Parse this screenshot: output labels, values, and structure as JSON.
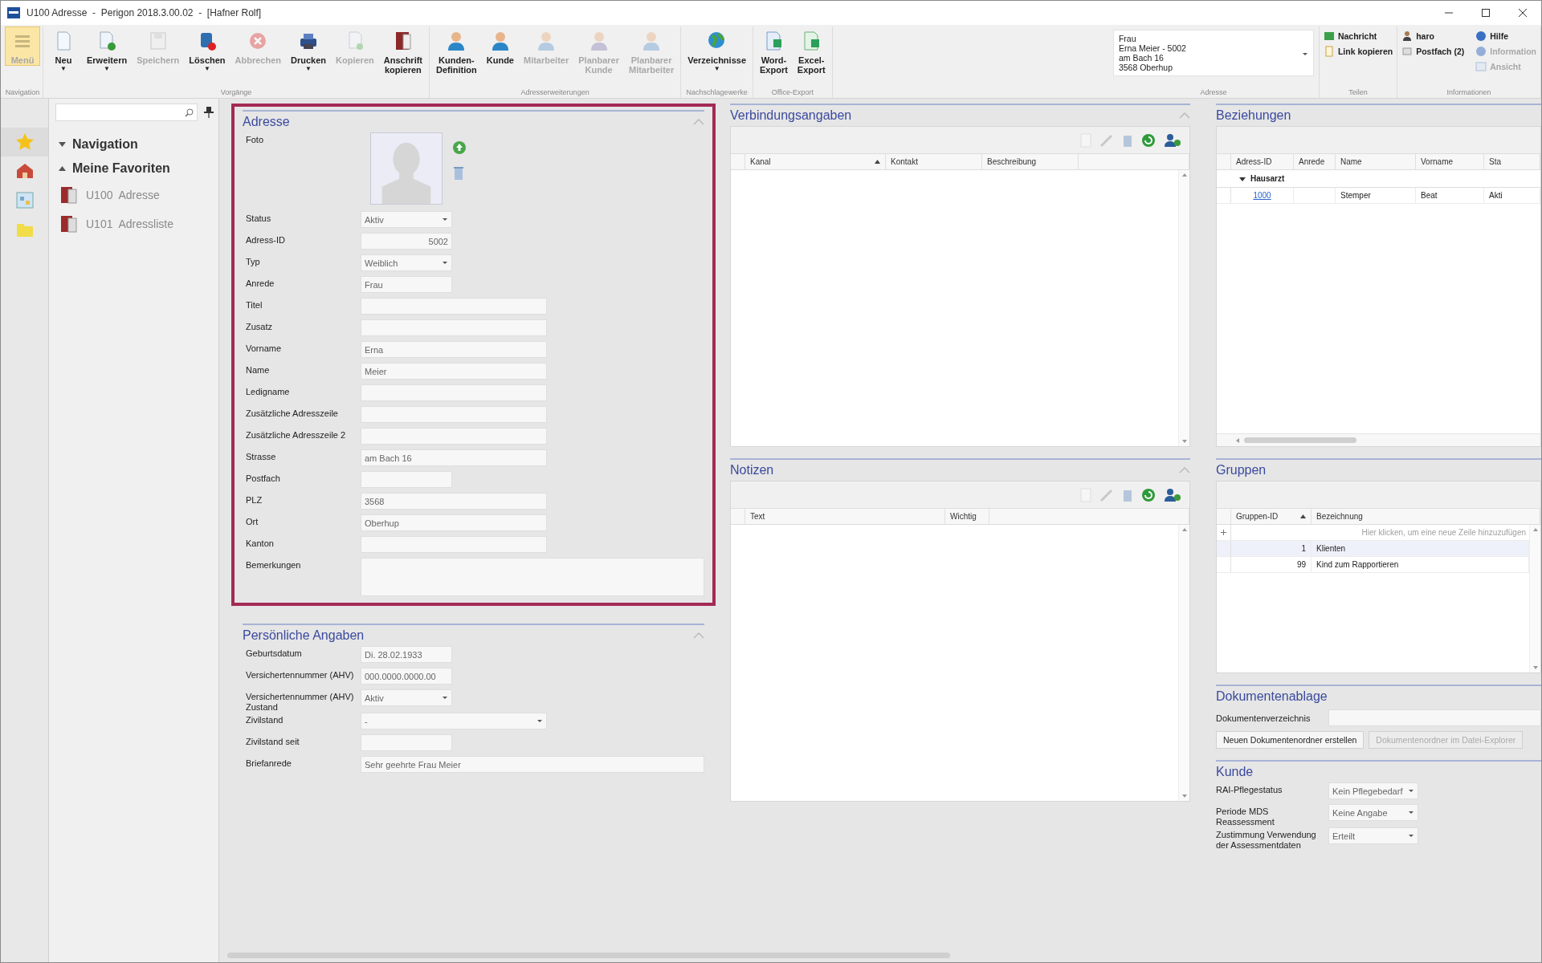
{
  "window": {
    "title": "U100 Adresse  -  Perigon 2018.3.00.02  -  [Hafner Rolf]"
  },
  "ribbon": {
    "groups": [
      {
        "kind": "large",
        "label": "Navigation",
        "buttons": [
          {
            "label": "Menü",
            "disabled": true,
            "highlighted": true
          }
        ]
      },
      {
        "kind": "large",
        "label": "Vorgänge",
        "buttons": [
          {
            "label": "Neu",
            "arrow": "▼",
            "disabled": false,
            "highlighted": false
          },
          {
            "label": "Erweitern",
            "arrow": "▼",
            "disabled": false,
            "highlighted": false
          },
          {
            "label": "Speichern",
            "disabled": true,
            "highlighted": false
          },
          {
            "label": "Löschen",
            "arrow": "▼",
            "disabled": false,
            "highlighted": false
          },
          {
            "label": "Abbrechen",
            "disabled": true,
            "highlighted": false
          },
          {
            "label": "Drucken",
            "arrow": "▼",
            "disabled": false,
            "highlighted": false
          },
          {
            "label": "Kopieren",
            "disabled": true,
            "highlighted": false
          },
          {
            "label": "Anschrift\nkopieren",
            "disabled": false,
            "highlighted": false
          }
        ]
      },
      {
        "kind": "large",
        "label": "Adresserweiterungen",
        "buttons": [
          {
            "label": "Kunden-\nDefinition",
            "disabled": false,
            "highlighted": false
          },
          {
            "label": "Kunde",
            "disabled": false,
            "highlighted": false
          },
          {
            "label": "Mitarbeiter",
            "disabled": true,
            "highlighted": false
          },
          {
            "label": "Planbarer\nKunde",
            "disabled": true,
            "highlighted": false
          },
          {
            "label": "Planbarer\nMitarbeiter",
            "disabled": true,
            "highlighted": false
          }
        ]
      },
      {
        "kind": "large",
        "label": "Nachschlagewerke",
        "buttons": [
          {
            "label": "Verzeichnisse",
            "arrow": "▼",
            "disabled": false,
            "highlighted": false
          }
        ]
      },
      {
        "kind": "large",
        "label": "Office-Export",
        "buttons": [
          {
            "label": "Word-\nExport",
            "disabled": false,
            "highlighted": false
          },
          {
            "label": "Excel-\nExport",
            "disabled": false,
            "highlighted": false
          }
        ]
      },
      {
        "kind": "address",
        "label": "Adresse",
        "lines": [
          "Frau",
          "Erna Meier - 5002",
          "am Bach 16",
          "3568 Oberhup"
        ]
      },
      {
        "kind": "small",
        "label": "Teilen",
        "columns": [
          [
            {
              "label": "Nachricht",
              "disabled": false
            },
            {
              "label": "Link kopieren",
              "disabled": false
            }
          ]
        ]
      },
      {
        "kind": "small",
        "label": "Informationen",
        "columns": [
          [
            {
              "label": "haro",
              "disabled": false
            },
            {
              "label": "Postfach (2)",
              "disabled": false
            }
          ],
          [
            {
              "label": "Hilfe",
              "disabled": false
            },
            {
              "label": "Information",
              "disabled": true
            },
            {
              "label": "Ansicht",
              "disabled": true
            }
          ]
        ]
      }
    ]
  },
  "nav_strip": [
    {
      "selected": true
    },
    {
      "selected": false
    },
    {
      "selected": false
    },
    {
      "selected": false
    }
  ],
  "navigation": {
    "tree": [
      {
        "label": "Navigation",
        "expanded": false
      },
      {
        "label": "Meine Favoriten",
        "expanded": true,
        "children": [
          {
            "code": "U100",
            "label": "Adresse"
          },
          {
            "code": "U101",
            "label": "Adressliste"
          }
        ]
      }
    ]
  },
  "address_section": {
    "title": "Adresse",
    "highlighted": true,
    "fields": [
      {
        "label": "Foto"
      },
      {
        "kind": "select",
        "label": "Status",
        "value": "Aktiv"
      },
      {
        "kind": "number",
        "label": "Adress-ID",
        "value": "5002"
      },
      {
        "kind": "select",
        "label": "Typ",
        "value": "Weiblich"
      },
      {
        "kind": "short",
        "label": "Anrede",
        "value": "Frau"
      },
      {
        "kind": "text",
        "label": "Titel"
      },
      {
        "kind": "text",
        "label": "Zusatz"
      },
      {
        "kind": "text",
        "label": "Vorname",
        "value": "Erna"
      },
      {
        "kind": "text",
        "label": "Name",
        "value": "Meier"
      },
      {
        "kind": "text",
        "label": "Ledigname"
      },
      {
        "kind": "text",
        "label": "Zusätzliche Adresszeile"
      },
      {
        "kind": "text",
        "label": "Zusätzliche Adresszeile 2"
      },
      {
        "kind": "text",
        "label": "Strasse",
        "value": "am Bach 16"
      },
      {
        "kind": "short",
        "label": "Postfach"
      },
      {
        "kind": "text",
        "label": "PLZ",
        "value": "3568"
      },
      {
        "kind": "text",
        "label": "Ort",
        "value": "Oberhup"
      },
      {
        "kind": "text",
        "label": "Kanton"
      },
      {
        "kind": "memo",
        "label": "Bemerkungen"
      }
    ]
  },
  "personal_section": {
    "title": "Persönliche Angaben",
    "highlighted": false,
    "fields": [
      {
        "kind": "short",
        "label": "Geburtsdatum",
        "value": "Di. 28.02.1933"
      },
      {
        "kind": "short",
        "label": "Versichertennummer (AHV)",
        "value": "000.0000.0000.00"
      },
      {
        "kind": "select",
        "label": "Versichertennummer (AHV)\nZustand",
        "value": "Aktiv"
      },
      {
        "kind": "select_long",
        "label": "Zivilstand",
        "value": "-"
      },
      {
        "kind": "short",
        "label": "Zivilstand seit"
      },
      {
        "kind": "wide",
        "label": "Briefanrede",
        "value": "Sehr geehrte Frau Meier"
      }
    ]
  },
  "grids": [
    {
      "title": "Verbindungsangaben",
      "tools": true,
      "columns": [
        {
          "label": "Kanal",
          "sorted": true
        },
        {
          "label": "Kontakt",
          "sorted": false
        },
        {
          "label": "Beschreibung",
          "sorted": false
        }
      ]
    },
    {
      "title": "Beziehungen",
      "tools": false,
      "columns": [
        {
          "label": "Adress-ID",
          "sorted": false,
          "kind": "link"
        },
        {
          "label": "Anrede",
          "sorted": false,
          "kind": "text"
        },
        {
          "label": "Name",
          "sorted": false,
          "kind": "text"
        },
        {
          "label": "Vorname",
          "sorted": false,
          "kind": "text"
        },
        {
          "label": "Sta",
          "sorted": false,
          "kind": "text"
        }
      ],
      "group": {
        "label": "Hausarzt",
        "expanded": true
      },
      "rows": [
        {
          "selected": false,
          "cells": [
            "1000",
            null,
            "Stemper",
            "Beat",
            "Akti"
          ]
        }
      ]
    },
    {
      "title": "Notizen",
      "tools": true,
      "columns": [
        {
          "label": "Text",
          "sorted": false
        },
        {
          "label": "Wichtig",
          "sorted": false
        }
      ]
    },
    {
      "title": "Gruppen",
      "tools": false,
      "columns": [
        {
          "label": "Gruppen-ID",
          "sorted": true,
          "kind": "number"
        },
        {
          "label": "Bezeichnung",
          "sorted": false,
          "kind": "text"
        }
      ],
      "new_row": "Hier klicken, um eine neue Zeile hinzuzufügen",
      "rows": [
        {
          "selected": true,
          "cells": [
            "1",
            "Klienten"
          ]
        },
        {
          "selected": false,
          "cells": [
            "99",
            "Kind zum Rapportieren"
          ]
        }
      ]
    }
  ],
  "documents": {
    "title": "Dokumentenablage",
    "label": "Dokumentenverzeichnis",
    "buttons": [
      {
        "label": "Neuen Dokumentenordner erstellen",
        "disabled": false
      },
      {
        "label": "Dokumentenordner im Datei-Explorer",
        "disabled": true
      }
    ]
  },
  "customer": {
    "title": "Kunde",
    "fields": [
      {
        "label": "RAI-Pflegestatus",
        "value": "Kein Pflegebedarf"
      },
      {
        "label": "Periode MDS Reassessment",
        "value": "Keine Angabe"
      },
      {
        "label": "Zustimmung Verwendung\nder Assessmentdaten",
        "value": "Erteilt"
      }
    ]
  }
}
